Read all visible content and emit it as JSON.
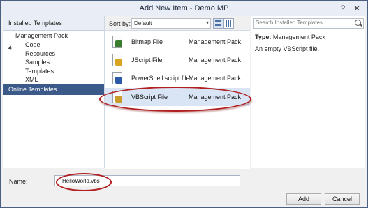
{
  "window": {
    "title": "Add New Item - Demo.MP",
    "help_icon": "?",
    "close_icon": "✕"
  },
  "left_panel": {
    "header": "Installed Templates",
    "tree": {
      "root": "Management Pack",
      "children": [
        "Code",
        "Resources",
        "Samples",
        "Templates",
        "XML"
      ],
      "selected": "Resources"
    },
    "online": "Online Templates"
  },
  "toolbar": {
    "sort_label": "Sort by:",
    "sort_value": "Default"
  },
  "templates": [
    {
      "name": "Bitmap File",
      "category": "Management Pack",
      "icon": "bitmap-file-icon",
      "color": "#3a7d2f"
    },
    {
      "name": "JScript File",
      "category": "Management Pack",
      "icon": "jscript-file-icon",
      "color": "#d9a521"
    },
    {
      "name": "PowerShell script file",
      "category": "Management Pack",
      "icon": "powershell-file-icon",
      "color": "#2a5aa8"
    },
    {
      "name": "VBScript File",
      "category": "Management Pack",
      "icon": "vbscript-file-icon",
      "color": "#c89b2a"
    }
  ],
  "selected_template": "VBScript File",
  "details": {
    "search_placeholder": "Search Installed Templates",
    "type_label": "Type:",
    "type_value": "Management Pack",
    "description": "An empty  VBScript file."
  },
  "footer": {
    "name_label": "Name:",
    "name_value": "HelloWorld.vbs",
    "add_label": "Add",
    "cancel_label": "Cancel"
  },
  "colors": {
    "highlight_ellipse": "#b11f20",
    "online_bg": "#3b5a89"
  }
}
